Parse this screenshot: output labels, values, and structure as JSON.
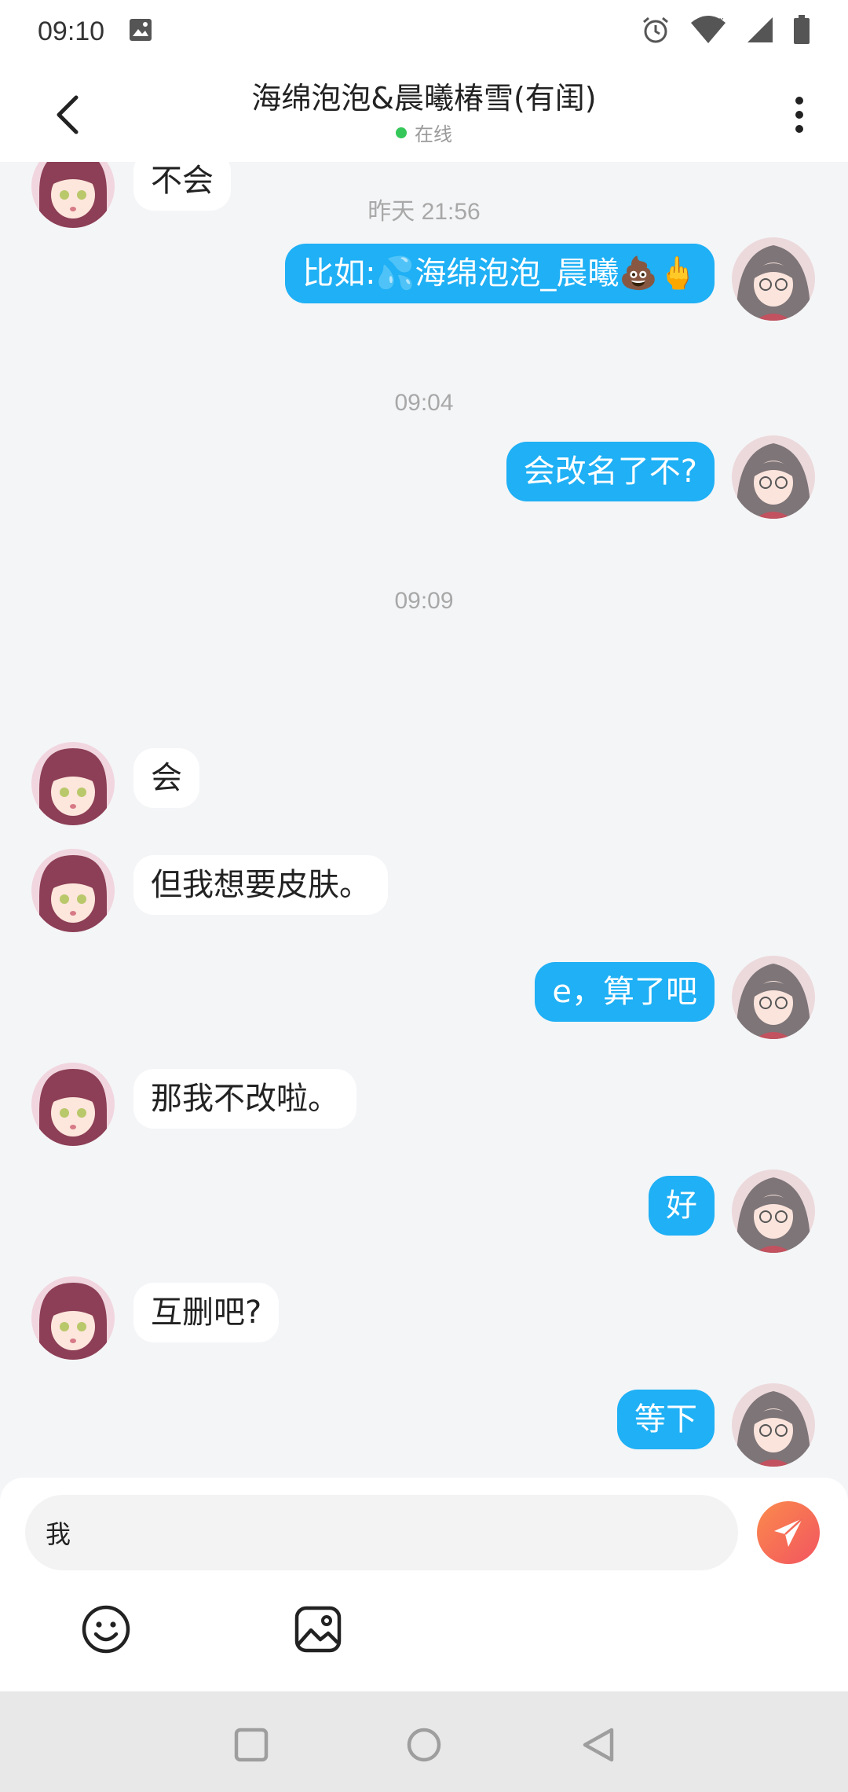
{
  "status_bar": {
    "time": "09:10"
  },
  "header": {
    "title": "海绵泡泡&晨曦椿雪(有闺)",
    "status": "在线"
  },
  "timestamps": [
    "昨天 21:56",
    "09:04",
    "09:09"
  ],
  "messages": [
    {
      "dir": "in",
      "text": "不会"
    },
    {
      "dir": "out",
      "text": "比如:💦海绵泡泡_晨曦💩🖕"
    },
    {
      "dir": "out",
      "text": "会改名了不?"
    },
    {
      "dir": "in",
      "text": "会"
    },
    {
      "dir": "in",
      "text": "但我想要皮肤。"
    },
    {
      "dir": "out",
      "text": "e，算了吧"
    },
    {
      "dir": "in",
      "text": "那我不改啦。"
    },
    {
      "dir": "out",
      "text": "好"
    },
    {
      "dir": "in",
      "text": "互删吧?"
    },
    {
      "dir": "out",
      "text": "等下"
    }
  ],
  "composer": {
    "value": "我"
  },
  "colors": {
    "outgoing_bubble": "#1fb0f5",
    "incoming_bubble": "#ffffff",
    "online_dot": "#35c759",
    "send_button": "#f25560"
  },
  "icons": {
    "back": "chevron-left-icon",
    "more": "more-vertical-icon",
    "send": "paper-plane-icon",
    "emoji": "smiley-icon",
    "image": "image-icon"
  }
}
